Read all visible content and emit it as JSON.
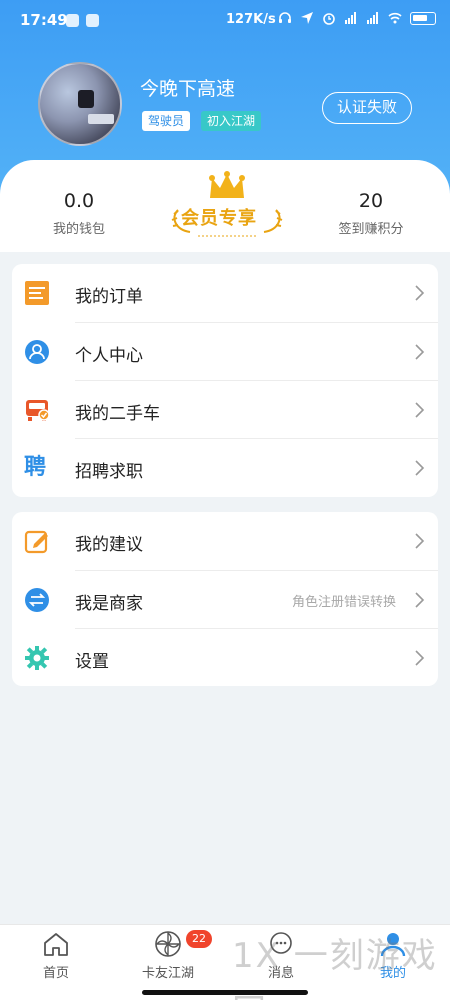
{
  "status_bar": {
    "time": "17:49",
    "speed": "127K/s"
  },
  "profile": {
    "username": "今晚下高速",
    "role_tag": "驾驶员",
    "level_tag": "初入江湖",
    "verify_label": "认证失败"
  },
  "stats": {
    "wallet_value": "0.0",
    "wallet_label": "我的钱包",
    "vip_label": "会员专享",
    "points_value": "20",
    "points_label": "签到赚积分"
  },
  "menu_group_1": [
    {
      "label": "我的订单",
      "icon": "orders-icon"
    },
    {
      "label": "个人中心",
      "icon": "person-icon"
    },
    {
      "label": "我的二手车",
      "icon": "used-truck-icon"
    },
    {
      "label": "招聘求职",
      "icon": "recruit-icon",
      "icon_text": "聘"
    }
  ],
  "menu_group_2": [
    {
      "label": "我的建议",
      "icon": "edit-icon"
    },
    {
      "label": "我是商家",
      "icon": "switch-icon",
      "hint": "角色注册错误转换"
    },
    {
      "label": "设置",
      "icon": "gear-icon"
    }
  ],
  "bottom_nav": {
    "items": [
      {
        "label": "首页",
        "icon": "home-icon"
      },
      {
        "label": "卡友江湖",
        "icon": "pinwheel-icon",
        "badge": "22"
      },
      {
        "label": "消息",
        "icon": "chat-icon"
      },
      {
        "label": "我的",
        "icon": "profile-icon",
        "active": true
      }
    ]
  },
  "watermark": "1X 一刻游戏网",
  "colors": {
    "primary": "#3d9df4",
    "accent_teal": "#38c8c8",
    "badge_red": "#f0442c",
    "orange": "#f39a2a",
    "gold": "#e9a412"
  }
}
